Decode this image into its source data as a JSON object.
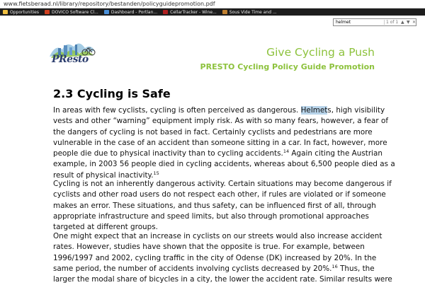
{
  "browser": {
    "url": "www.fietsberaad.nl/library/repository/bestanden/policyguidepromotion.pdf",
    "bookmarks": [
      {
        "label": "Opportunities",
        "icon": "folder-icon",
        "color": "#f0c040"
      },
      {
        "label": "DOVICO Software Cl...",
        "icon": "dovico-icon",
        "color": "#d04020"
      },
      {
        "label": "Dashboard - Portlan...",
        "icon": "page-icon",
        "color": "#4a90d9"
      },
      {
        "label": "CellarTracker - Wine...",
        "icon": "cellartracker-icon",
        "color": "#b02020"
      },
      {
        "label": "Sous Vide Time and ...",
        "icon": "page-icon",
        "color": "#c08030"
      }
    ],
    "find": {
      "query": "helmet",
      "count": "1 of 1"
    }
  },
  "doc": {
    "logo_text": "PResto",
    "title": "Give Cycling a Push",
    "subtitle": "PRESTO Cycling Policy Guide Promotion",
    "heading": "2.3 Cycling is Safe",
    "p1": {
      "l1a": "In areas with few cyclists, cycling is often perceived as dangerous. ",
      "l1hl": "Helmet",
      "l1b": "s, high visibility",
      "l2": "vests and other “warning” equipment imply risk. As with so many fears, however, a fear of",
      "l3": "the dangers of cycling is not based in fact. Certainly cyclists and pedestrians are more",
      "l4": "vulnerable in the case of an accident than someone sitting in a car. In fact, however, more",
      "l5a": "people die due to physical inactivity than to cycling accidents.",
      "l5sup": "14",
      "l5b": " Again citing the Austrian",
      "l6": "example, in 2003 56 people died in cycling accidents, whereas about 6,500 people died as a",
      "l7a": "result of physical inactivity.",
      "l7sup": "15"
    },
    "p2": {
      "l1": "Cycling is not an inherently dangerous activity. Certain situations may become dangerous if",
      "l2": "cyclists and other road users do not respect each other, if rules are violated or if someone",
      "l3": "makes an error. These situations, and thus safety, can be influenced first of all, through",
      "l4": "appropriate infrastructure and speed limits, but also through promotional approaches",
      "l5": "targeted at different groups."
    },
    "p3": {
      "l1": "One might expect that an increase in cyclists on our streets would also increase accident",
      "l2": "rates. However, studies have shown that the opposite is true. For example, between",
      "l3": "1996/1997 and 2002, cycling traffic in the city of Odense (DK) increased by 20%. In the",
      "l4a": "same period, the number of accidents involving cyclists decreased by 20%.",
      "l4sup": "16",
      "l4b": " Thus, the",
      "l5": "larger the modal share of bicycles in a city, the lower the accident rate. Similar results were"
    }
  }
}
